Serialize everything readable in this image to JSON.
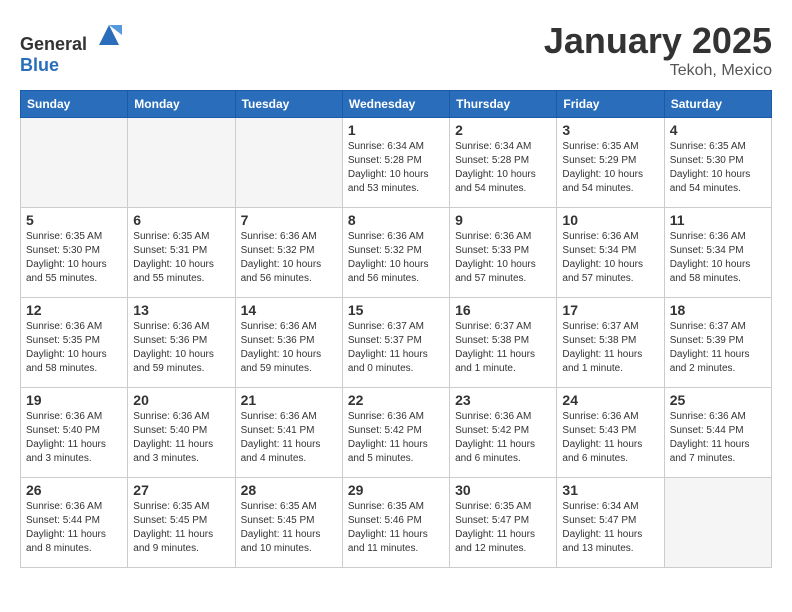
{
  "header": {
    "logo_general": "General",
    "logo_blue": "Blue",
    "title": "January 2025",
    "subtitle": "Tekoh, Mexico"
  },
  "days_of_week": [
    "Sunday",
    "Monday",
    "Tuesday",
    "Wednesday",
    "Thursday",
    "Friday",
    "Saturday"
  ],
  "weeks": [
    [
      {
        "day": "",
        "text": ""
      },
      {
        "day": "",
        "text": ""
      },
      {
        "day": "",
        "text": ""
      },
      {
        "day": "1",
        "text": "Sunrise: 6:34 AM\nSunset: 5:28 PM\nDaylight: 10 hours\nand 53 minutes."
      },
      {
        "day": "2",
        "text": "Sunrise: 6:34 AM\nSunset: 5:28 PM\nDaylight: 10 hours\nand 54 minutes."
      },
      {
        "day": "3",
        "text": "Sunrise: 6:35 AM\nSunset: 5:29 PM\nDaylight: 10 hours\nand 54 minutes."
      },
      {
        "day": "4",
        "text": "Sunrise: 6:35 AM\nSunset: 5:30 PM\nDaylight: 10 hours\nand 54 minutes."
      }
    ],
    [
      {
        "day": "5",
        "text": "Sunrise: 6:35 AM\nSunset: 5:30 PM\nDaylight: 10 hours\nand 55 minutes."
      },
      {
        "day": "6",
        "text": "Sunrise: 6:35 AM\nSunset: 5:31 PM\nDaylight: 10 hours\nand 55 minutes."
      },
      {
        "day": "7",
        "text": "Sunrise: 6:36 AM\nSunset: 5:32 PM\nDaylight: 10 hours\nand 56 minutes."
      },
      {
        "day": "8",
        "text": "Sunrise: 6:36 AM\nSunset: 5:32 PM\nDaylight: 10 hours\nand 56 minutes."
      },
      {
        "day": "9",
        "text": "Sunrise: 6:36 AM\nSunset: 5:33 PM\nDaylight: 10 hours\nand 57 minutes."
      },
      {
        "day": "10",
        "text": "Sunrise: 6:36 AM\nSunset: 5:34 PM\nDaylight: 10 hours\nand 57 minutes."
      },
      {
        "day": "11",
        "text": "Sunrise: 6:36 AM\nSunset: 5:34 PM\nDaylight: 10 hours\nand 58 minutes."
      }
    ],
    [
      {
        "day": "12",
        "text": "Sunrise: 6:36 AM\nSunset: 5:35 PM\nDaylight: 10 hours\nand 58 minutes."
      },
      {
        "day": "13",
        "text": "Sunrise: 6:36 AM\nSunset: 5:36 PM\nDaylight: 10 hours\nand 59 minutes."
      },
      {
        "day": "14",
        "text": "Sunrise: 6:36 AM\nSunset: 5:36 PM\nDaylight: 10 hours\nand 59 minutes."
      },
      {
        "day": "15",
        "text": "Sunrise: 6:37 AM\nSunset: 5:37 PM\nDaylight: 11 hours\nand 0 minutes."
      },
      {
        "day": "16",
        "text": "Sunrise: 6:37 AM\nSunset: 5:38 PM\nDaylight: 11 hours\nand 1 minute."
      },
      {
        "day": "17",
        "text": "Sunrise: 6:37 AM\nSunset: 5:38 PM\nDaylight: 11 hours\nand 1 minute."
      },
      {
        "day": "18",
        "text": "Sunrise: 6:37 AM\nSunset: 5:39 PM\nDaylight: 11 hours\nand 2 minutes."
      }
    ],
    [
      {
        "day": "19",
        "text": "Sunrise: 6:36 AM\nSunset: 5:40 PM\nDaylight: 11 hours\nand 3 minutes."
      },
      {
        "day": "20",
        "text": "Sunrise: 6:36 AM\nSunset: 5:40 PM\nDaylight: 11 hours\nand 3 minutes."
      },
      {
        "day": "21",
        "text": "Sunrise: 6:36 AM\nSunset: 5:41 PM\nDaylight: 11 hours\nand 4 minutes."
      },
      {
        "day": "22",
        "text": "Sunrise: 6:36 AM\nSunset: 5:42 PM\nDaylight: 11 hours\nand 5 minutes."
      },
      {
        "day": "23",
        "text": "Sunrise: 6:36 AM\nSunset: 5:42 PM\nDaylight: 11 hours\nand 6 minutes."
      },
      {
        "day": "24",
        "text": "Sunrise: 6:36 AM\nSunset: 5:43 PM\nDaylight: 11 hours\nand 6 minutes."
      },
      {
        "day": "25",
        "text": "Sunrise: 6:36 AM\nSunset: 5:44 PM\nDaylight: 11 hours\nand 7 minutes."
      }
    ],
    [
      {
        "day": "26",
        "text": "Sunrise: 6:36 AM\nSunset: 5:44 PM\nDaylight: 11 hours\nand 8 minutes."
      },
      {
        "day": "27",
        "text": "Sunrise: 6:35 AM\nSunset: 5:45 PM\nDaylight: 11 hours\nand 9 minutes."
      },
      {
        "day": "28",
        "text": "Sunrise: 6:35 AM\nSunset: 5:45 PM\nDaylight: 11 hours\nand 10 minutes."
      },
      {
        "day": "29",
        "text": "Sunrise: 6:35 AM\nSunset: 5:46 PM\nDaylight: 11 hours\nand 11 minutes."
      },
      {
        "day": "30",
        "text": "Sunrise: 6:35 AM\nSunset: 5:47 PM\nDaylight: 11 hours\nand 12 minutes."
      },
      {
        "day": "31",
        "text": "Sunrise: 6:34 AM\nSunset: 5:47 PM\nDaylight: 11 hours\nand 13 minutes."
      },
      {
        "day": "",
        "text": ""
      }
    ]
  ]
}
